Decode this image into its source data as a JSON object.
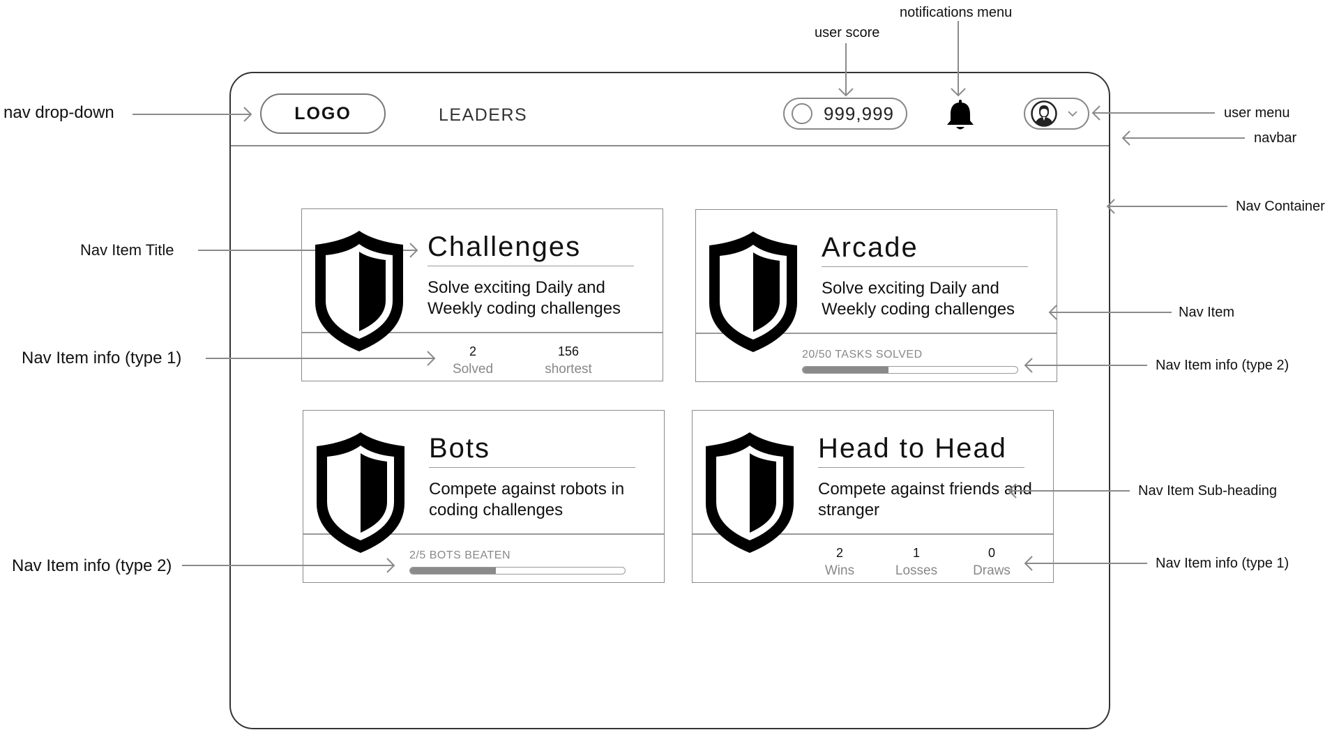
{
  "annotations": {
    "nav_dropdown": "nav drop-down",
    "user_score": "user score",
    "notifications_menu": "notifications menu",
    "user_menu": "user menu",
    "navbar": "navbar",
    "nav_container": "Nav Container",
    "nav_item_title": "Nav Item Title",
    "nav_item": "Nav Item",
    "nav_item_info_type1_left": "Nav Item info (type 1)",
    "nav_item_info_type2_right": "Nav Item info (type 2)",
    "nav_item_subheading": "Nav Item Sub-heading",
    "nav_item_info_type2_left": "Nav Item info (type 2)",
    "nav_item_info_type1_right": "Nav Item info (type 1)"
  },
  "navbar": {
    "logo_label": "LOGO",
    "leaders_label": "LEADERS",
    "score": "999,999"
  },
  "icons": {
    "coin": "coin-icon",
    "bell": "bell-icon",
    "avatar": "avatar-icon",
    "chevron": "chevron-down-icon",
    "shield": "shield-icon"
  },
  "cards": {
    "challenges": {
      "title": "Challenges",
      "desc": "Solve exciting Daily and Weekly coding challenges",
      "stats": [
        {
          "value": "2",
          "label": "Solved"
        },
        {
          "value": "156",
          "label": "shortest"
        }
      ]
    },
    "arcade": {
      "title": "Arcade",
      "desc": "Solve exciting Daily and Weekly coding challenges",
      "progress_label": "20/50 TASKS SOLVED",
      "progress": 0.4
    },
    "bots": {
      "title": "Bots",
      "desc": "Compete against robots in coding challenges",
      "progress_label": "2/5 BOTS BEATEN",
      "progress": 0.4
    },
    "head_to_head": {
      "title": "Head to Head",
      "desc": "Compete against friends and stranger",
      "stats": [
        {
          "value": "2",
          "label": "Wins"
        },
        {
          "value": "1",
          "label": "Losses"
        },
        {
          "value": "0",
          "label": "Draws"
        }
      ]
    }
  }
}
